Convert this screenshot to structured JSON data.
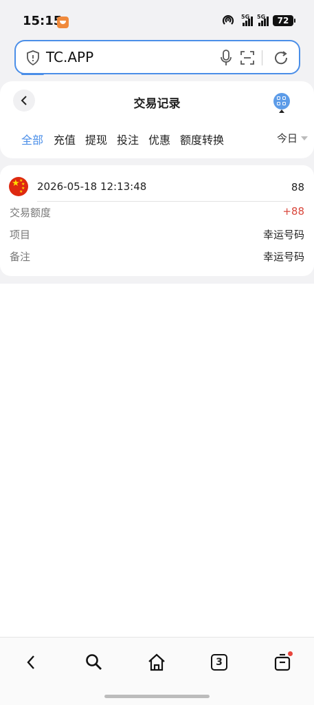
{
  "status_bar": {
    "time": "15:15",
    "battery": "72",
    "signal_1_label": "5G",
    "signal_2_label": "5G"
  },
  "browser": {
    "url": "TC.APP",
    "tab_count": "3"
  },
  "header": {
    "title": "交易记录"
  },
  "tabs": [
    {
      "label": "全部",
      "active": true
    },
    {
      "label": "充值",
      "active": false
    },
    {
      "label": "提现",
      "active": false
    },
    {
      "label": "投注",
      "active": false
    },
    {
      "label": "优惠",
      "active": false
    },
    {
      "label": "额度转换",
      "active": false
    }
  ],
  "date_filter": {
    "label": "今日"
  },
  "record": {
    "timestamp": "2026-05-18 12:13:48",
    "amount": "88",
    "rows": [
      {
        "label": "交易额度",
        "value": "+88"
      },
      {
        "label": "项目",
        "value": "幸运号码"
      },
      {
        "label": "备注",
        "value": "幸运号码"
      }
    ]
  },
  "colors": {
    "accent": "#4a8ee8",
    "positive_amount": "#d9473c"
  }
}
